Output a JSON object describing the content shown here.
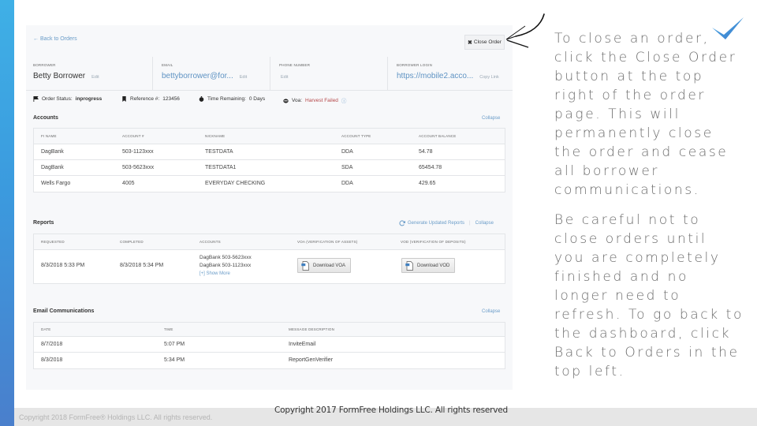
{
  "colors": {
    "accent_bar_top": "#3fb0e6",
    "accent_bar_bottom": "#4a7fcc",
    "link": "#6a9cc8",
    "failed": "#b5484a",
    "checkmark": "#3a8fd8"
  },
  "icons": {
    "back": "arrow-left-icon",
    "close": "x-icon",
    "flag": "flag-icon",
    "bookmark": "bookmark-icon",
    "timer": "stopwatch-icon",
    "voa": "cloud-icon",
    "help": "question-circle-icon",
    "refresh": "refresh-icon",
    "document": "document-icon",
    "annotation_arrow": "hand-drawn-arrow-icon",
    "checkmark": "checkmark-icon"
  },
  "header": {
    "back_link": "← Back to Orders",
    "close_order_icon": "✖",
    "close_order_label": "Close Order"
  },
  "info": {
    "borrower_label": "Borrower",
    "borrower_value": "Betty Borrower",
    "borrower_action": "Edit",
    "email_label": "Email",
    "email_value": "bettyborrower@for...",
    "email_action": "Edit",
    "phone_label": "Phone Number",
    "phone_action": "Edit",
    "login_label": "Borrower Login",
    "login_value": "https://mobile2.acco...",
    "login_action": "Copy Link"
  },
  "status": {
    "order_status_label": "Order Status:",
    "order_status_value": "inprogress",
    "reference_label": "Reference #:",
    "reference_value": "123456",
    "time_label": "Time Remaining:",
    "time_value": "0 Days",
    "voa_label": "Voa:",
    "voa_value": "Harvest Failed",
    "help_glyph": "ⓘ"
  },
  "accounts": {
    "title": "Accounts",
    "collapse": "Collapse",
    "columns": [
      "FI Name",
      "Account #",
      "Nickname",
      "Account Type",
      "Account Balance"
    ],
    "rows": [
      [
        "DagBank",
        "503-1123xxx",
        "TESTDATA",
        "DDA",
        "54.78"
      ],
      [
        "DagBank",
        "503-5623xxx",
        "TESTDATA1",
        "SDA",
        "65454.78"
      ],
      [
        "Wells Fargo",
        "4005",
        "EVERYDAY CHECKING",
        "DDA",
        "429.65"
      ]
    ]
  },
  "reports": {
    "title": "Reports",
    "generate": "Generate Updated Reports",
    "separator": "|",
    "collapse": "Collapse",
    "columns": [
      "Requested",
      "Completed",
      "Accounts",
      "VOA (Verification of Assets)",
      "VOD (Verification of Deposits)"
    ],
    "row": {
      "requested": "8/3/2018 5:33 PM",
      "completed": "8/3/2018 5:34 PM",
      "accounts": [
        "DagBank 503-5623xxx",
        "DagBank 503-1123xxx"
      ],
      "show_more": "[+] Show More",
      "download_voa": "Download VOA",
      "download_vod": "Download VOD"
    }
  },
  "emails": {
    "title": "Email Communications",
    "collapse": "Collapse",
    "columns": [
      "Date",
      "Time",
      "Message Description"
    ],
    "rows": [
      [
        "8/7/2018",
        "5:07 PM",
        "InviteEmail"
      ],
      [
        "8/3/2018",
        "5:34 PM",
        "ReportGenVerifier"
      ]
    ]
  },
  "footer": {
    "app_copyright": "Copyright 2018 FormFree® Holdings LLC. All rights reserved.",
    "slide_copyright": "Copyright 2017 FormFree Holdings LLC. All rights reserved"
  },
  "notes": {
    "paragraph1": "To close an order, click the Close Order button at the top right of the order page. This will permanently close the order and cease all borrower communications.",
    "paragraph2": "Be careful not to close orders until you are completely finished and no longer need to refresh. To go back to the dashboard, click Back to Orders in the top left."
  }
}
